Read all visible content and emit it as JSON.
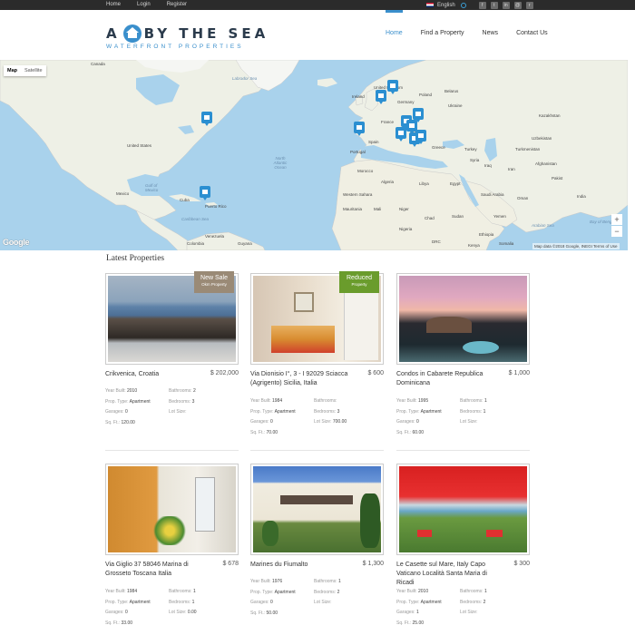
{
  "topbar": {
    "links": [
      "Home",
      "Login",
      "Register"
    ],
    "language": "English"
  },
  "logo": {
    "letter": "A",
    "words": "BY THE SEA",
    "tagline": "WATERFRONT PROPERTIES"
  },
  "nav": [
    "Home",
    "Find a Property",
    "News",
    "Contact Us"
  ],
  "map": {
    "type_buttons": [
      "Map",
      "Satellite"
    ],
    "zoom_in": "+",
    "zoom_out": "−",
    "google": "Google",
    "attribution": "Map data ©2018 Google, INEGI   Terms of Use",
    "labels": {
      "canada": "Canada",
      "labrador": "Labrador Sea",
      "us": "United States",
      "mexico": "Mexico",
      "gulf": "Gulf of Mexico",
      "cuba": "Cuba",
      "caribbean": "Caribbean Sea",
      "puertorico": "Puerto Rico",
      "venezuela": "Venezuela",
      "colombia": "Colombia",
      "guyana": "Guyana",
      "natlantic": "North Atlantic Ocean",
      "ireland": "Ireland",
      "unitedkingdom": "United Kingdom",
      "germany": "Germany",
      "poland": "Poland",
      "ukraine": "Ukraine",
      "france": "France",
      "spain": "Spain",
      "portugal": "Portugal",
      "italy": "Italy",
      "greece": "Greece",
      "turkey": "Turkey",
      "belarus": "Belarus",
      "kazakhstan": "Kazakhstan",
      "uzbekistan": "Uzbekistan",
      "turkmenistan": "Turkmenistan",
      "afghanistan": "Afghanistan",
      "iran": "Iran",
      "iraq": "Iraq",
      "syria": "Syria",
      "saudi": "Saudi Arabia",
      "oman": "Oman",
      "yemen": "Yemen",
      "egypt": "Egypt",
      "libya": "Libya",
      "algeria": "Algeria",
      "morocco": "Morocco",
      "mauritania": "Mauritania",
      "mali": "Mali",
      "niger": "Niger",
      "chad": "Chad",
      "sudan": "Sudan",
      "ethiopia": "Ethiopia",
      "nigeria": "Nigeria",
      "somalia": "Somalia",
      "arabiansea": "Arabian Sea",
      "bengal": "Bay of Benga",
      "pakistan": "Pakist",
      "india": "India",
      "western": "Western Sahara",
      "kenya": "Kenya",
      "drc": "DRC"
    }
  },
  "section_title": "Latest Properties",
  "labels": {
    "year": "Year Built:",
    "type": "Prop. Type:",
    "garages": "Garages:",
    "sqft": "Sq. Ft.:",
    "bathrooms": "Bathrooms:",
    "bedrooms": "Bedrooms:",
    "lot": "Lot Size:"
  },
  "properties": [
    {
      "title": "Crikvenica, Croatia",
      "price": "$ 202,000",
      "ribbon": {
        "label": "New Sale",
        "sub": "Okm Property"
      },
      "year": "2010",
      "type": "Apartment",
      "garages": "0",
      "sqft": "120.00",
      "bathrooms": "2",
      "bedrooms": "3",
      "lot": ""
    },
    {
      "title": "Via Dionisio I°, 3 - I 92029 Sciacca (Agrigento) Sicilia, Italia",
      "price": "$ 600",
      "ribbon": {
        "label": "Reduced",
        "sub": "Property"
      },
      "year": "1984",
      "type": "Apartment",
      "garages": "0",
      "sqft": "70.00",
      "bathrooms": "",
      "bedrooms": "3",
      "lot": "700.00"
    },
    {
      "title": "Condos in Cabarete Republica Dominicana",
      "price": "$ 1,000",
      "year": "1995",
      "type": "Apartment",
      "garages": "0",
      "sqft": "60.00",
      "bathrooms": "1",
      "bedrooms": "1",
      "lot": ""
    },
    {
      "title": "Via Giglio 37 58046 Marina di Grosseto Toscana Italia",
      "price": "$ 678",
      "year": "1984",
      "type": "Apartment",
      "garages": "0",
      "sqft": "33.00",
      "bathrooms": "1",
      "bedrooms": "1",
      "lot": "0.00"
    },
    {
      "title": "Marines du Fiumalto",
      "price": "$ 1,300",
      "year": "1976",
      "type": "Apartment",
      "garages": "0",
      "sqft": "50.00",
      "bathrooms": "1",
      "bedrooms": "2",
      "lot": ""
    },
    {
      "title": "Le Casette sul Mare, Italy Capo Vaticano Località Santa Maria di Ricadi",
      "price": "$ 300",
      "year": "2010",
      "type": "Apartment",
      "garages": "1",
      "sqft": "25.00",
      "bathrooms": "1",
      "bedrooms": "2",
      "lot": ""
    }
  ],
  "colors": {
    "accent": "#3a8fcc",
    "topbar": "#2b2b2b",
    "ocean": "#a9d2ec",
    "land": "#eef0e6",
    "marker": "#2b8fd1",
    "sale_ribbon": "#9a8a76",
    "reduced_ribbon": "#6a9c2c"
  }
}
